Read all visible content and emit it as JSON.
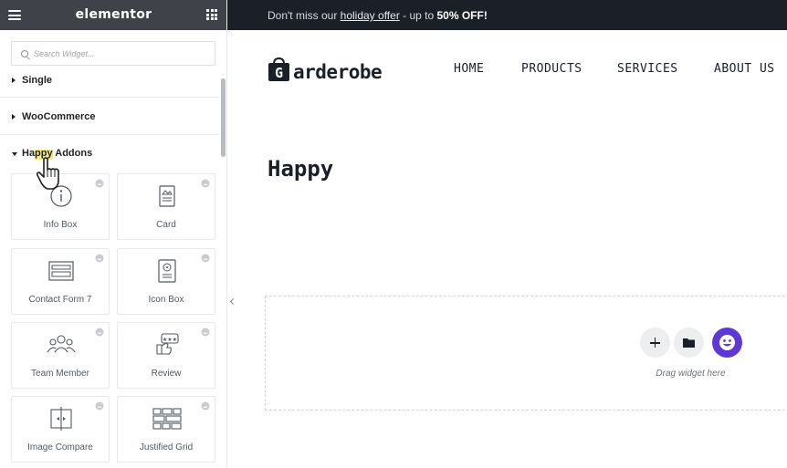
{
  "sidebar": {
    "brand": "elementor",
    "search_placeholder": "Search Widget...",
    "categories": [
      {
        "label": "Single",
        "open": false
      },
      {
        "label": "WooCommerce",
        "open": false
      },
      {
        "label": "Happy Addons",
        "open": true
      }
    ],
    "widgets": [
      {
        "label": "Info Box",
        "icon": "info-box-icon"
      },
      {
        "label": "Card",
        "icon": "card-icon"
      },
      {
        "label": "Contact Form 7",
        "icon": "contact-form-icon"
      },
      {
        "label": "Icon Box",
        "icon": "icon-box-icon"
      },
      {
        "label": "Team Member",
        "icon": "team-member-icon"
      },
      {
        "label": "Review",
        "icon": "review-icon"
      },
      {
        "label": "Image Compare",
        "icon": "image-compare-icon"
      },
      {
        "label": "Justified Grid",
        "icon": "justified-grid-icon"
      }
    ]
  },
  "promo": {
    "prefix": "Don't miss our ",
    "link": "holiday offer",
    "middle": " - up to ",
    "highlight": "50% OFF!"
  },
  "site": {
    "logo_letter": "G",
    "logo_text": "arderobe",
    "nav": [
      "HOME",
      "PRODUCTS",
      "SERVICES",
      "ABOUT US"
    ],
    "heading": "Happy",
    "dropzone_hint": "Drag widget here"
  },
  "colors": {
    "sidebar_header": "#3f4349",
    "promo_bar": "#1b1f27",
    "happy_accent": "#5d38d4"
  }
}
